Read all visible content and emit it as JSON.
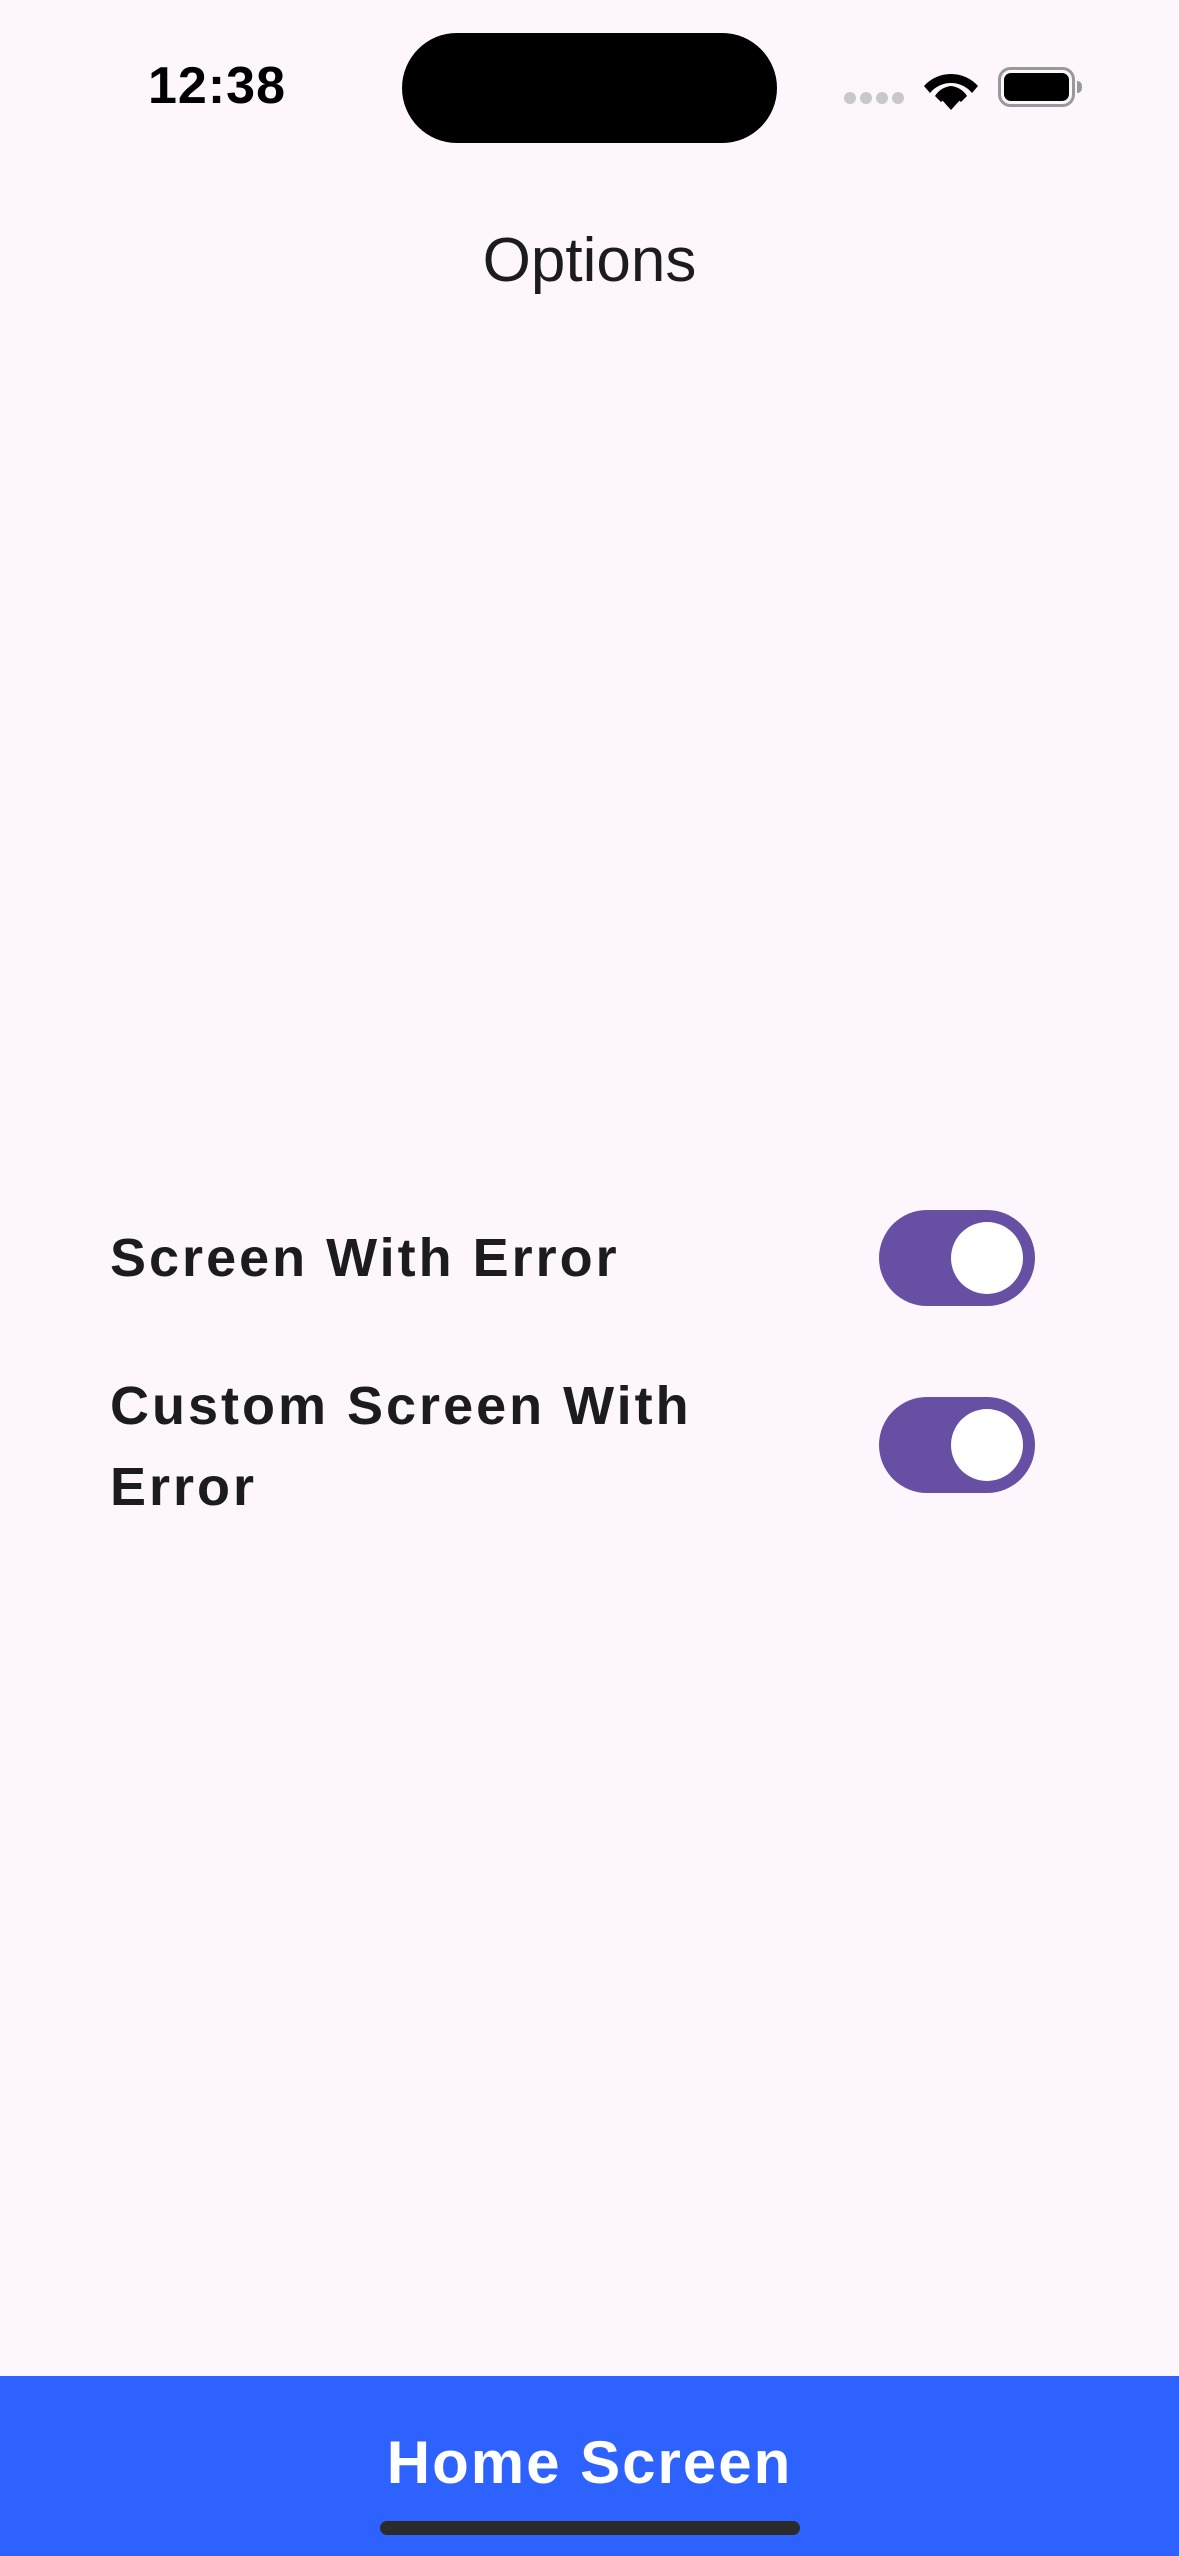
{
  "status_bar": {
    "time": "12:38",
    "icons": [
      "cellular-signal-icon",
      "wifi-icon",
      "battery-icon"
    ]
  },
  "header": {
    "title": "Options"
  },
  "options": [
    {
      "label": "Screen With Error",
      "enabled": true
    },
    {
      "label": "Custom Screen With Error",
      "enabled": true
    }
  ],
  "bottom_button": {
    "label": "Home Screen"
  },
  "colors": {
    "background": "#fdf7fd",
    "toggle_on": "#6750a4",
    "bottom_button": "#2e62ff",
    "text": "#1c1b1f"
  }
}
